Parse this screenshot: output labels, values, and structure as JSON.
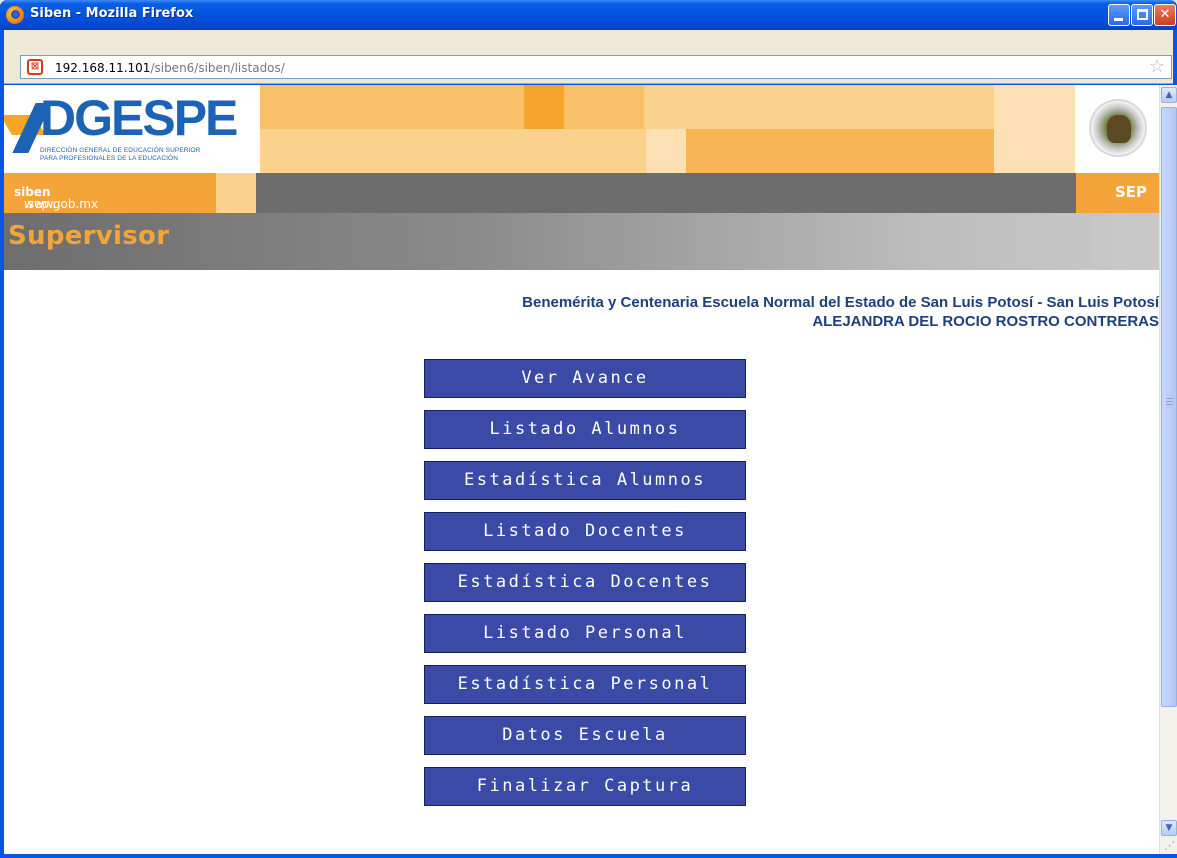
{
  "window": {
    "title": "Siben - Mozilla Firefox",
    "buttons": {
      "minimize": "minimize",
      "maximize": "maximize",
      "close": "✕"
    }
  },
  "addressbar": {
    "url_host": "192.168.11.101",
    "url_path": "/siben6/siben/listados/"
  },
  "header": {
    "logo_text": "DGESPE",
    "logo_line1": "DIRECCIÓN GENERAL DE EDUCACIÓN SUPERIOR",
    "logo_line2": "PARA  PROFESIONALES  DE  LA  EDUCACIÓN",
    "site_prefix": "www.",
    "site_bold": "siben",
    "site_suffix": ".sep.gob.mx",
    "sep_label": "SEP"
  },
  "role_title": "Supervisor",
  "school": {
    "name": "Benemérita y Centenaria Escuela Normal del Estado de San Luis Potosí - San Luis Potosí",
    "user": "ALEJANDRA DEL ROCIO ROSTRO CONTRERAS"
  },
  "menu": [
    {
      "label": "Ver Avance"
    },
    {
      "label": "Listado Alumnos"
    },
    {
      "label": "Estadística Alumnos"
    },
    {
      "label": "Listado Docentes"
    },
    {
      "label": "Estadística Docentes"
    },
    {
      "label": "Listado Personal"
    },
    {
      "label": "Estadística Personal"
    },
    {
      "label": "Datos Escuela"
    },
    {
      "label": "Finalizar Captura"
    }
  ],
  "colors": {
    "button_bg": "#3a4aa6",
    "orange": "#f5a43a",
    "light_orange": "#fbd18e",
    "school_text": "#1d3f7a"
  },
  "icons": {
    "titlebar": "firefox-icon",
    "site": "xampp-site-icon",
    "bookmark": "star-icon",
    "seal": "mexico-seal-icon"
  }
}
